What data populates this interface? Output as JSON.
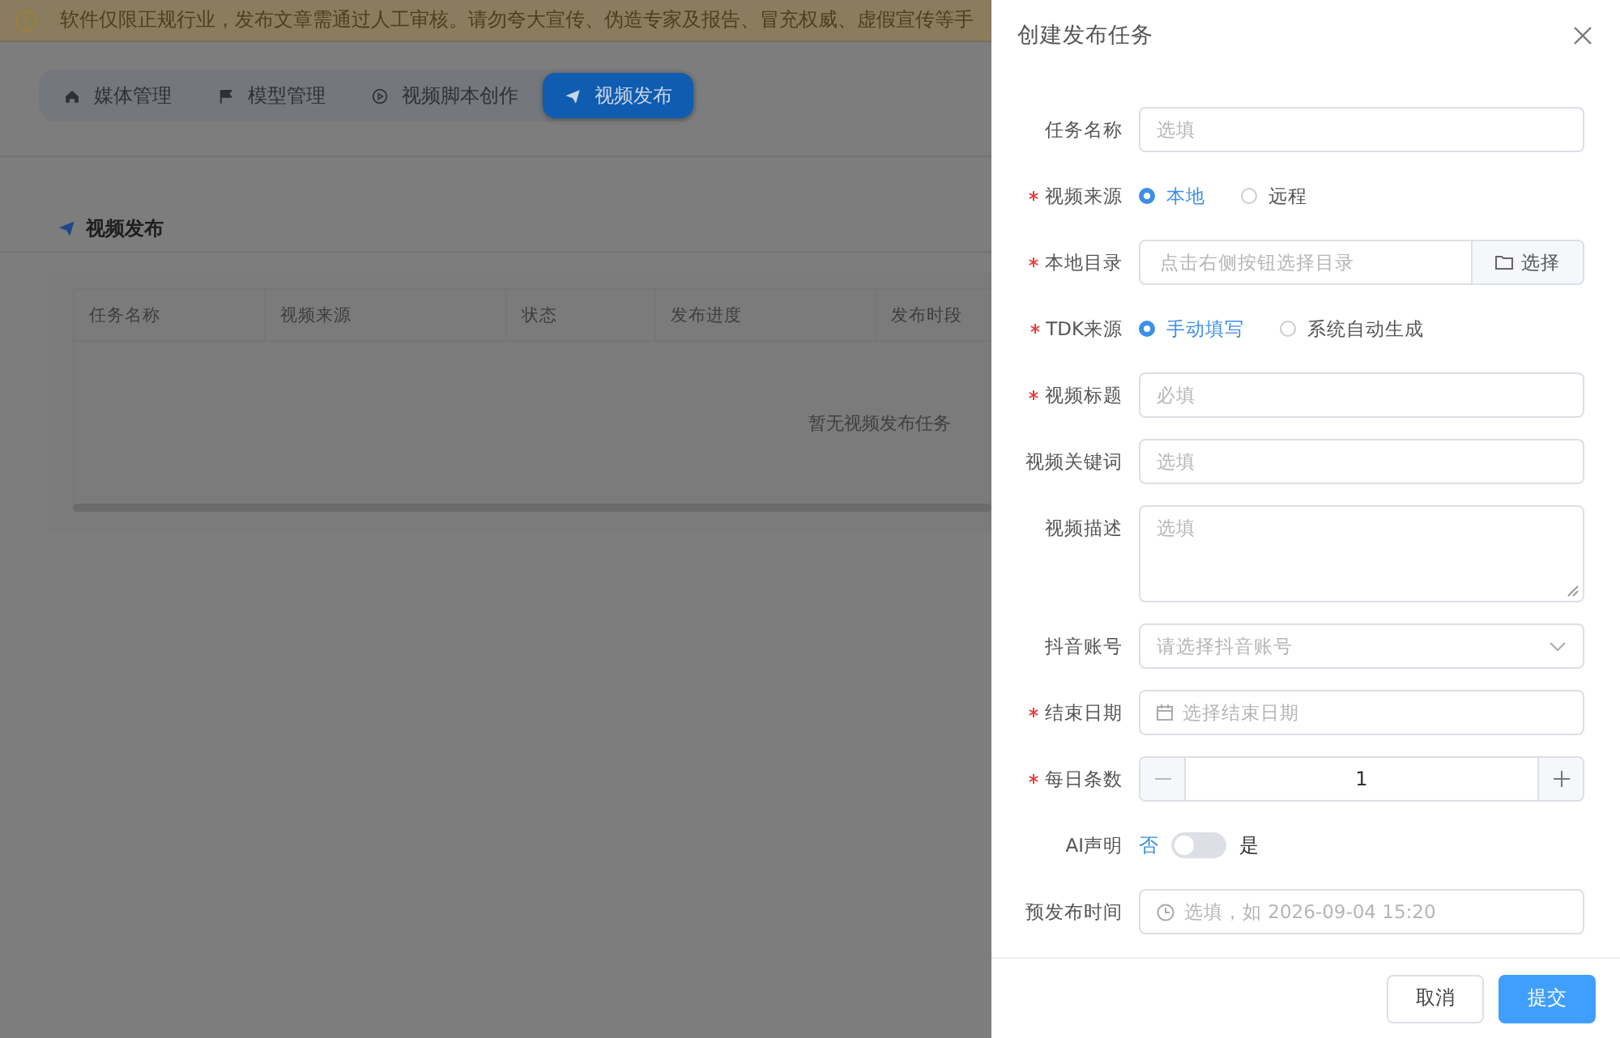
{
  "notice": {
    "text": "软件仅限正规行业，发布文章需通过人工审核。请勿夸大宣传、伪造专家及报告、冒充权威、虚假宣传等手"
  },
  "nav_tabs": [
    {
      "label": "媒体管理",
      "selected": false
    },
    {
      "label": "模型管理",
      "selected": false
    },
    {
      "label": "视频脚本创作",
      "selected": false
    },
    {
      "label": "视频发布",
      "selected": true
    }
  ],
  "section_title": "视频发布",
  "table": {
    "columns": [
      "任务名称",
      "视频来源",
      "状态",
      "发布进度",
      "发布时段"
    ],
    "empty_text": "暂无视频发布任务"
  },
  "drawer": {
    "title": "创建发布任务",
    "fields": [
      {
        "kind": "input",
        "label": "任务名称",
        "required": false,
        "placeholder": "选填"
      },
      {
        "kind": "radio",
        "label": "视频来源",
        "required": true,
        "options": [
          {
            "label": "本地",
            "selected": true
          },
          {
            "label": "远程",
            "selected": false
          }
        ]
      },
      {
        "kind": "directory",
        "label": "本地目录",
        "required": true,
        "placeholder": "点击右侧按钮选择目录",
        "button": "选择"
      },
      {
        "kind": "radio",
        "label": "TDK来源",
        "required": true,
        "options": [
          {
            "label": "手动填写",
            "selected": true
          },
          {
            "label": "系统自动生成",
            "selected": false
          }
        ]
      },
      {
        "kind": "input",
        "label": "视频标题",
        "required": true,
        "placeholder": "必填"
      },
      {
        "kind": "input",
        "label": "视频关键词",
        "required": false,
        "placeholder": "选填"
      },
      {
        "kind": "textarea",
        "label": "视频描述",
        "required": false,
        "placeholder": "选填"
      },
      {
        "kind": "select",
        "label": "抖音账号",
        "required": false,
        "placeholder": "请选择抖音账号"
      },
      {
        "kind": "date",
        "label": "结束日期",
        "required": true,
        "placeholder": "选择结束日期"
      },
      {
        "kind": "number",
        "label": "每日条数",
        "required": true,
        "value": "1"
      },
      {
        "kind": "switch",
        "label": "AI声明",
        "required": false,
        "on": false,
        "off_label": "否",
        "on_label": "是"
      },
      {
        "kind": "time",
        "label": "预发布时间",
        "required": false,
        "placeholder": "选填，如 2026-09-04 15:20"
      }
    ],
    "buttons": [
      {
        "label": "取消",
        "kind": "secondary"
      },
      {
        "label": "提交",
        "kind": "primary"
      }
    ]
  }
}
